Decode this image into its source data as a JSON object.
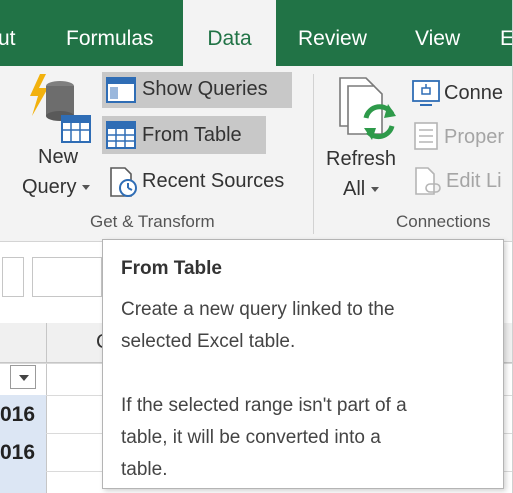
{
  "ribbon_tabs": [
    {
      "label": "ut"
    },
    {
      "label": "Formulas"
    },
    {
      "label": "Data"
    },
    {
      "label": "Review"
    },
    {
      "label": "View"
    },
    {
      "label": "E"
    }
  ],
  "get_transform": {
    "new_query_label_line1": "New",
    "new_query_label_line2": "Query",
    "show_queries": "Show Queries",
    "from_table": "From Table",
    "recent_sources": "Recent Sources",
    "group_label": "Get & Transform"
  },
  "connections": {
    "refresh_all_line1": "Refresh",
    "refresh_all_line2": "All",
    "connections": "Conne",
    "properties": "Proper",
    "edit_links": "Edit Li",
    "group_label": "Connections"
  },
  "sheet": {
    "column_letter": "C",
    "rows": [
      {
        "value": "016"
      },
      {
        "value": "016"
      }
    ]
  },
  "tooltip": {
    "title": "From Table",
    "line1": "Create a new query linked to the",
    "line2": "selected Excel table.",
    "line3": "If the selected range isn't part of a",
    "line4": "table, it will be converted into a",
    "line5": "table."
  },
  "colors": {
    "excel_green": "#217346",
    "ribbon_bg": "#f3f3f3",
    "highlight": "#c8c8c8"
  },
  "icons": [
    "new-query-icon",
    "show-queries-icon",
    "from-table-icon",
    "recent-sources-icon",
    "refresh-all-icon",
    "connections-icon",
    "properties-icon",
    "edit-links-icon",
    "filter-dropdown-icon"
  ]
}
